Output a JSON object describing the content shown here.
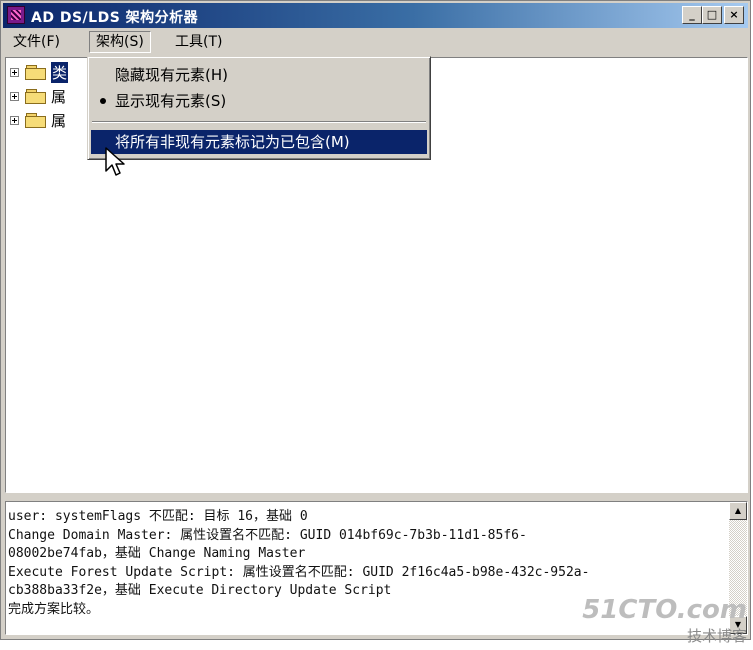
{
  "window": {
    "title": "AD DS/LDS 架构分析器",
    "controls": {
      "minimize": "_",
      "maximize": "□",
      "close": "×"
    }
  },
  "menubar": {
    "items": [
      {
        "label": "文件(F)"
      },
      {
        "label": "架构(S)"
      },
      {
        "label": "工具(T)"
      }
    ]
  },
  "tree": {
    "nodes": [
      {
        "label": "类"
      },
      {
        "label": "属"
      },
      {
        "label": "属"
      }
    ]
  },
  "dropdown": {
    "items": [
      {
        "label": "隐藏现有元素(H)",
        "checked": false
      },
      {
        "label": "显示现有元素(S)",
        "checked": true
      },
      {
        "label": "将所有非现有元素标记为已包含(M)",
        "highlighted": true
      }
    ]
  },
  "log": {
    "lines": [
      "user: systemFlags 不匹配: 目标 16，基础 0",
      "Change Domain Master: 属性设置名不匹配: GUID 014bf69c-7b3b-11d1-85f6-",
      "08002be74fab，基础 Change Naming Master",
      "Execute Forest Update Script: 属性设置名不匹配: GUID 2f16c4a5-b98e-432c-952a-",
      "cb388ba33f2e，基础 Execute Directory Update Script",
      "完成方案比较。"
    ]
  },
  "watermark": {
    "site": "51CTO.com",
    "tagline": "技术博客"
  },
  "colors": {
    "title_gradient_start": "#0a246a",
    "title_gradient_end": "#a6caf0",
    "highlight": "#0a246a",
    "face": "#d4d0c8"
  }
}
